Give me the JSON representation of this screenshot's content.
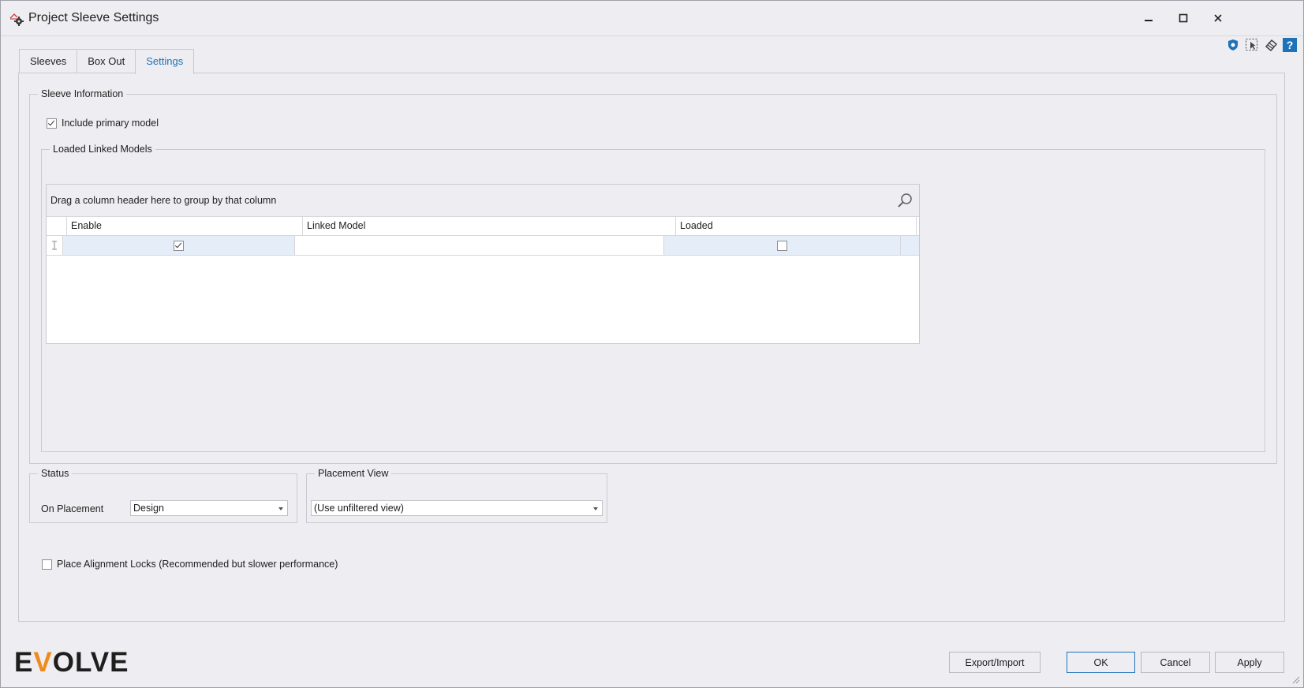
{
  "window": {
    "title": "Project Sleeve Settings"
  },
  "tabs": [
    {
      "label": "Sleeves",
      "active": false
    },
    {
      "label": "Box Out",
      "active": false
    },
    {
      "label": "Settings",
      "active": true
    }
  ],
  "sleeve_information": {
    "legend": "Sleeve Information",
    "include_primary_model": {
      "label": "Include primary model",
      "checked": true
    }
  },
  "loaded_linked_models": {
    "legend": "Loaded Linked Models",
    "group_hint": "Drag a column header here to group by that column",
    "columns": [
      "Enable",
      "Linked Model",
      "Loaded"
    ],
    "rows": [
      {
        "enable": true,
        "linked_model": "",
        "loaded": false
      }
    ]
  },
  "status": {
    "legend": "Status",
    "on_placement_label": "On Placement",
    "on_placement_value": "Design"
  },
  "placement_view": {
    "legend": "Placement View",
    "value": "(Use unfiltered view)"
  },
  "alignment_locks": {
    "label": "Place Alignment Locks (Recommended but slower performance)",
    "checked": false
  },
  "buttons": {
    "export_import": "Export/Import",
    "ok": "OK",
    "cancel": "Cancel",
    "apply": "Apply"
  },
  "logo": {
    "pre": "E",
    "accent": "V",
    "post": "OLVE"
  },
  "colors": {
    "accent": "#1f72b8",
    "logo_accent": "#f08a1c",
    "row_selected": "#e5eef8"
  }
}
